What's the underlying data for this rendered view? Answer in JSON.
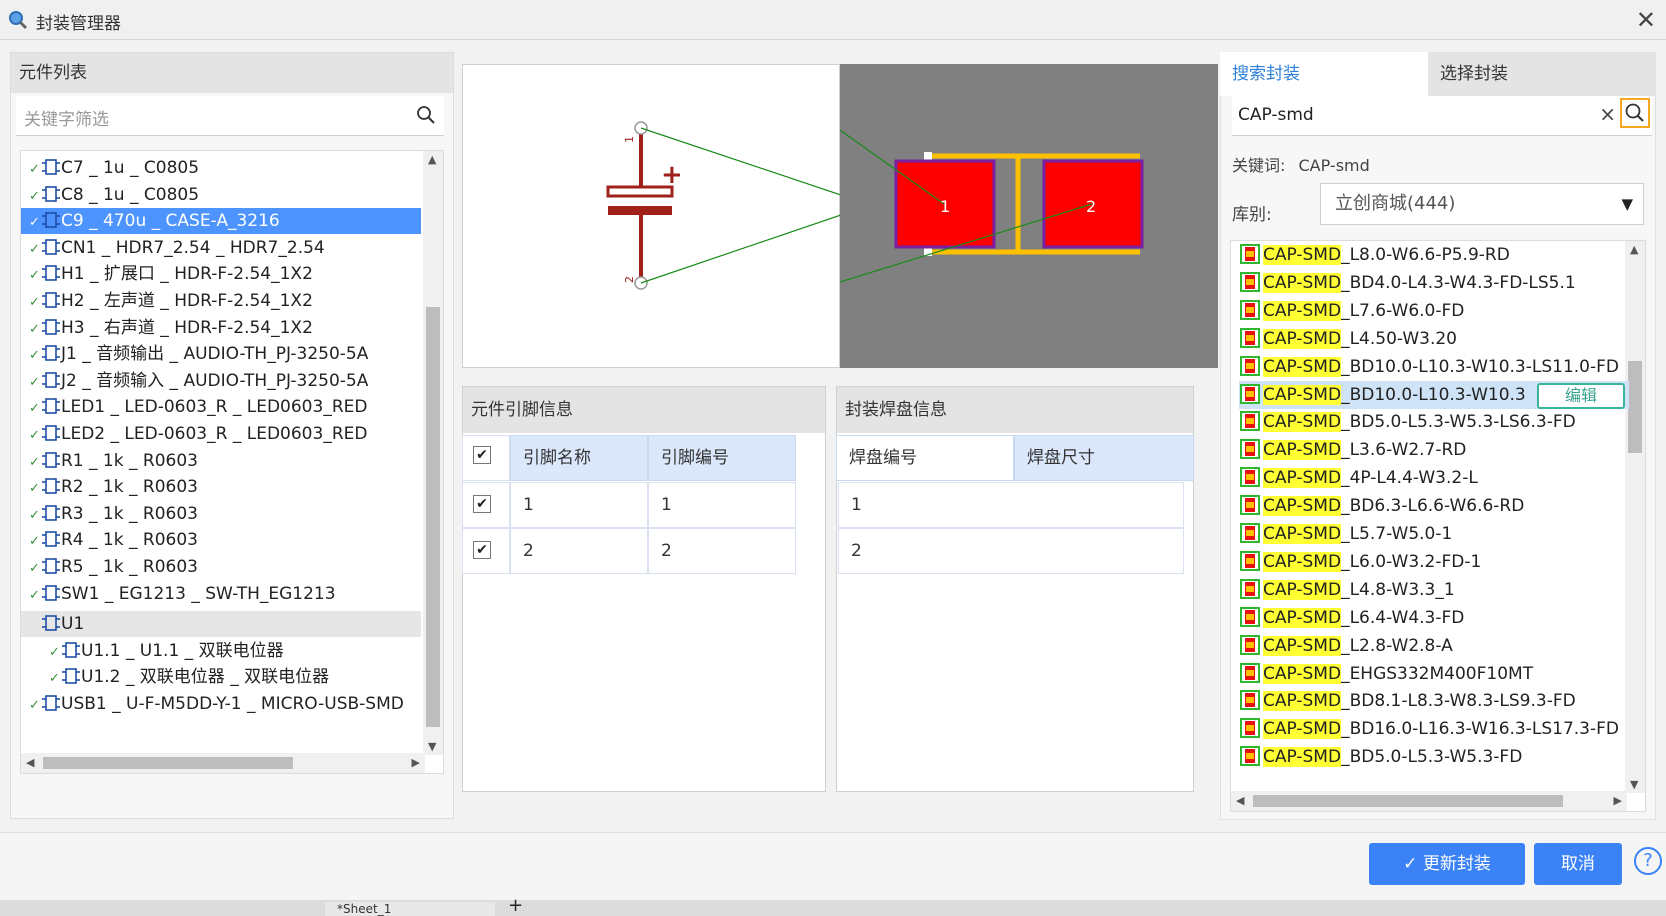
{
  "window": {
    "title": "封装管理器"
  },
  "left": {
    "header": "元件列表",
    "filter_placeholder": "关键字筛选",
    "items": [
      {
        "text": "C7 _ 1u _ C0805",
        "checked": true
      },
      {
        "text": "C8 _ 1u _ C0805",
        "checked": true
      },
      {
        "text": "C9 _ 470u _ CASE-A_3216",
        "checked": true,
        "selected": true
      },
      {
        "text": "CN1 _ HDR7_2.54 _ HDR7_2.54",
        "checked": true
      },
      {
        "text": "H1 _ 扩展口 _ HDR-F-2.54_1X2",
        "checked": true
      },
      {
        "text": "H2 _ 左声道 _ HDR-F-2.54_1X2",
        "checked": true
      },
      {
        "text": "H3 _ 右声道 _ HDR-F-2.54_1X2",
        "checked": true
      },
      {
        "text": "J1 _ 音频输出 _ AUDIO-TH_PJ-3250-5A",
        "checked": true
      },
      {
        "text": "J2 _ 音频输入 _ AUDIO-TH_PJ-3250-5A",
        "checked": true
      },
      {
        "text": "LED1 _ LED-0603_R _ LED0603_RED",
        "checked": true
      },
      {
        "text": "LED2 _ LED-0603_R _ LED0603_RED",
        "checked": true
      },
      {
        "text": "R1 _ 1k _ R0603",
        "checked": true
      },
      {
        "text": "R2 _ 1k _ R0603",
        "checked": true
      },
      {
        "text": "R3 _ 1k _ R0603",
        "checked": true
      },
      {
        "text": "R4 _ 1k _ R0603",
        "checked": true
      },
      {
        "text": "R5 _ 1k _ R0603",
        "checked": true
      },
      {
        "text": "SW1 _ EG1213 _ SW-TH_EG1213",
        "checked": true
      },
      {
        "text": "U1",
        "checked": false,
        "group": true
      },
      {
        "text": "U1.1 _ U1.1 _ 双联电位器",
        "checked": true,
        "indent": true
      },
      {
        "text": "U1.2 _ 双联电位器 _ 双联电位器",
        "checked": true,
        "indent": true
      },
      {
        "text": "USB1 _ U-F-M5DD-Y-1 _ MICRO-USB-SMD",
        "checked": true
      }
    ]
  },
  "preview": {
    "pad_labels": [
      "1",
      "2"
    ],
    "pin_labels": [
      "1",
      "2"
    ],
    "plus_sign": "+",
    "colors": {
      "pad": "#ff0000",
      "pad_border": "#7a1fa2",
      "silk": "#ffc000",
      "ratline": "#1a8a1a",
      "symbol": "#a0201a",
      "bg_pcb": "#808080"
    }
  },
  "pins": {
    "header": "元件引脚信息",
    "col_name": "引脚名称",
    "col_number": "引脚编号",
    "rows": [
      {
        "name": "1",
        "number": "1",
        "checked": true
      },
      {
        "name": "2",
        "number": "2",
        "checked": true
      }
    ]
  },
  "pads": {
    "header": "封装焊盘信息",
    "col_number": "焊盘编号",
    "col_size": "焊盘尺寸",
    "rows": [
      {
        "number": "1",
        "size": ""
      },
      {
        "number": "2",
        "size": ""
      }
    ]
  },
  "right": {
    "tab_search": "搜索封装",
    "tab_select": "选择封装",
    "search_value": "CAP-smd",
    "keyword_label": "关键词:",
    "keyword_value": "CAP-smd",
    "lib_label": "库别:",
    "lib_value": "立创商城(444)",
    "edit_label": "编辑",
    "highlight_prefix": "CAP-SMD",
    "items": [
      "_L8.0-W6.6-P5.9-RD",
      "_BD4.0-L4.3-W4.3-FD-LS5.1",
      "_L7.6-W6.0-FD",
      "_L4.50-W3.20",
      "_BD10.0-L10.3-W10.3-LS11.0-FD",
      "_BD10.0-L10.3-W10.3",
      "_BD5.0-L5.3-W5.3-LS6.3-FD",
      "_L3.6-W2.7-RD",
      "_4P-L4.4-W3.2-L",
      "_BD6.3-L6.6-W6.6-RD",
      "_L5.7-W5.0-1",
      "_L6.0-W3.2-FD-1",
      "_L4.8-W3.3_1",
      "_L6.4-W4.3-FD",
      "_L2.8-W2.8-A",
      "_EHGS332M400F10MT",
      "_BD8.1-L8.3-W8.3-LS9.3-FD",
      "_BD16.0-L16.3-W16.3-LS17.3-FD",
      "_BD5.0-L5.3-W5.3-FD"
    ],
    "highlight_index": 5
  },
  "footer": {
    "update_label": "更新封装",
    "cancel_label": "取消",
    "help_label": "?"
  },
  "statusbar": {
    "sheet_tab": "*Sheet_1",
    "add": "+"
  }
}
